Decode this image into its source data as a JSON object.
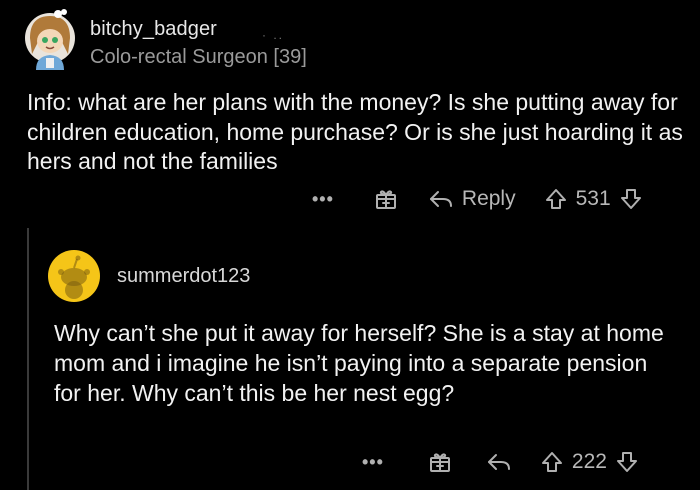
{
  "comments": [
    {
      "username": "bitchy_badger",
      "user_dots": "· ..",
      "flair": "Colo-rectal Surgeon [39]",
      "body": "Info: what are her plans with the money? Is she putting away for children education, home purchase? Or is she just hoarding it as hers and not the families",
      "actions": {
        "more": "•••",
        "award_icon": "gift-icon",
        "reply_icon": "reply-arrow-icon",
        "reply_label": "Reply",
        "upvote_icon": "upvote-arrow-icon",
        "votes": "531",
        "downvote_icon": "downvote-arrow-icon"
      }
    },
    {
      "username": "summerdot123",
      "body": "Why can’t she put it away for herself? She is a stay at home mom and i imagine he isn’t paying into a separate pension for her. Why can’t this be her nest egg?",
      "actions": {
        "more": "•••",
        "award_icon": "gift-icon",
        "reply_icon": "reply-arrow-icon",
        "upvote_icon": "upvote-arrow-icon",
        "votes": "222",
        "downvote_icon": "downvote-arrow-icon"
      }
    }
  ],
  "colors": {
    "background": "#000000",
    "text": "#f2f2f2",
    "muted": "#9a9a9a",
    "icon": "#b0b0b0",
    "thread_line": "#3a3a3a",
    "default_avatar_bg": "#f5c518"
  }
}
